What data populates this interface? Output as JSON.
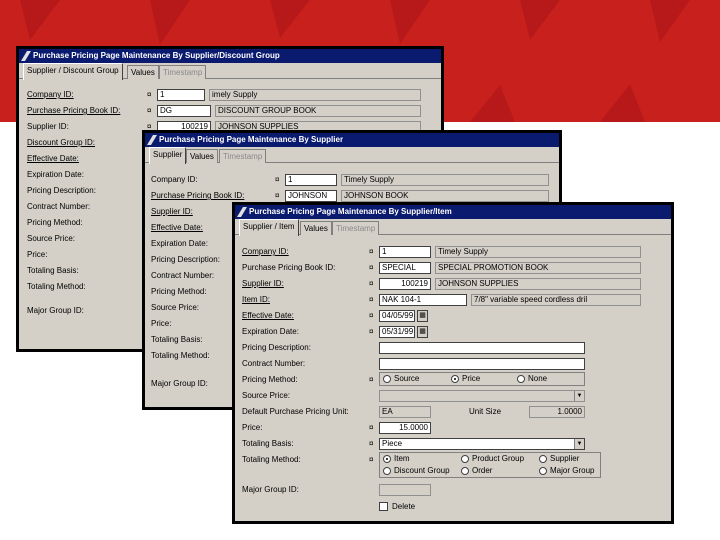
{
  "colors": {
    "banner": "#c8201c",
    "titlebar": "#0a1a6e",
    "window_bg": "#d4d0c8"
  },
  "win1": {
    "title": "Purchase Pricing Page Maintenance By Supplier/Discount Group",
    "tabs": [
      "Supplier / Discount Group",
      "Values",
      "Timestamp"
    ],
    "labels": [
      "Company ID:",
      "Purchase Pricing Book ID:",
      "Supplier ID:",
      "Discount Group ID:",
      "Effective Date:",
      "Expiration Date:",
      "Pricing Description:",
      "Contract Number:",
      "Pricing Method:",
      "Source Price:",
      "Price:",
      "Totaling Basis:",
      "Totaling Method:",
      "Major Group ID:"
    ],
    "company_id": "1",
    "company_name": "imely Supply",
    "book_id": "DG",
    "book_name": "DISCOUNT GROUP BOOK",
    "supplier_id": "100219",
    "supplier_name": "JOHNSON SUPPLIES"
  },
  "win2": {
    "title": "Purchase Pricing Page Maintenance By Supplier",
    "tabs": [
      "Supplier",
      "Values",
      "Timestamp"
    ],
    "labels": [
      "Company ID:",
      "Purchase Pricing Book ID:",
      "Supplier ID:",
      "Effective Date:",
      "Expiration Date:",
      "Pricing Description:",
      "Contract Number:",
      "Pricing Method:",
      "Source Price:",
      "Price:",
      "Totaling Basis:",
      "Totaling Method:",
      "Major Group ID:"
    ],
    "company_id": "1",
    "company_name": "Timely Supply",
    "book_id": "JOHNSON",
    "book_name": "JOHNSON BOOK"
  },
  "win3": {
    "title": "Purchase Pricing Page Maintenance By Supplier/Item",
    "tabs": [
      "Supplier / Item",
      "Values",
      "Timestamp"
    ],
    "company_label": "Company ID:",
    "company_id": "1",
    "company_name": "Timely Supply",
    "book_label": "Purchase Pricing Book ID:",
    "book_id": "SPECIAL",
    "book_name": "SPECIAL PROMOTION BOOK",
    "supplier_label": "Supplier ID:",
    "supplier_id": "100219",
    "supplier_name": "JOHNSON SUPPLIES",
    "item_label": "Item ID:",
    "item_id": "NAK 104-1",
    "item_desc": "7/8\" variable speed cordless dril",
    "eff_label": "Effective Date:",
    "eff_date": "04/05/99",
    "exp_label": "Expiration Date:",
    "exp_date": "05/31/99",
    "desc_label": "Pricing Description:",
    "contract_label": "Contract Number:",
    "method_label": "Pricing Method:",
    "method_options": [
      "Source",
      "Price",
      "None"
    ],
    "source_label": "Source Price:",
    "unit_label": "Default Purchase Pricing Unit:",
    "unit_value": "EA",
    "unitsize_label": "Unit Size",
    "unitsize_value": "1.0000",
    "price_label": "Price:",
    "price_value": "15.0000",
    "basis_label": "Totaling Basis:",
    "basis_value": "Piece",
    "totmethod_label": "Totaling Method:",
    "totmethod_options": [
      "Item",
      "Product Group",
      "Supplier",
      "Discount Group",
      "Order",
      "Major Group"
    ],
    "major_label": "Major Group ID:",
    "delete_label": "Delete",
    "req_mark": "¤"
  }
}
